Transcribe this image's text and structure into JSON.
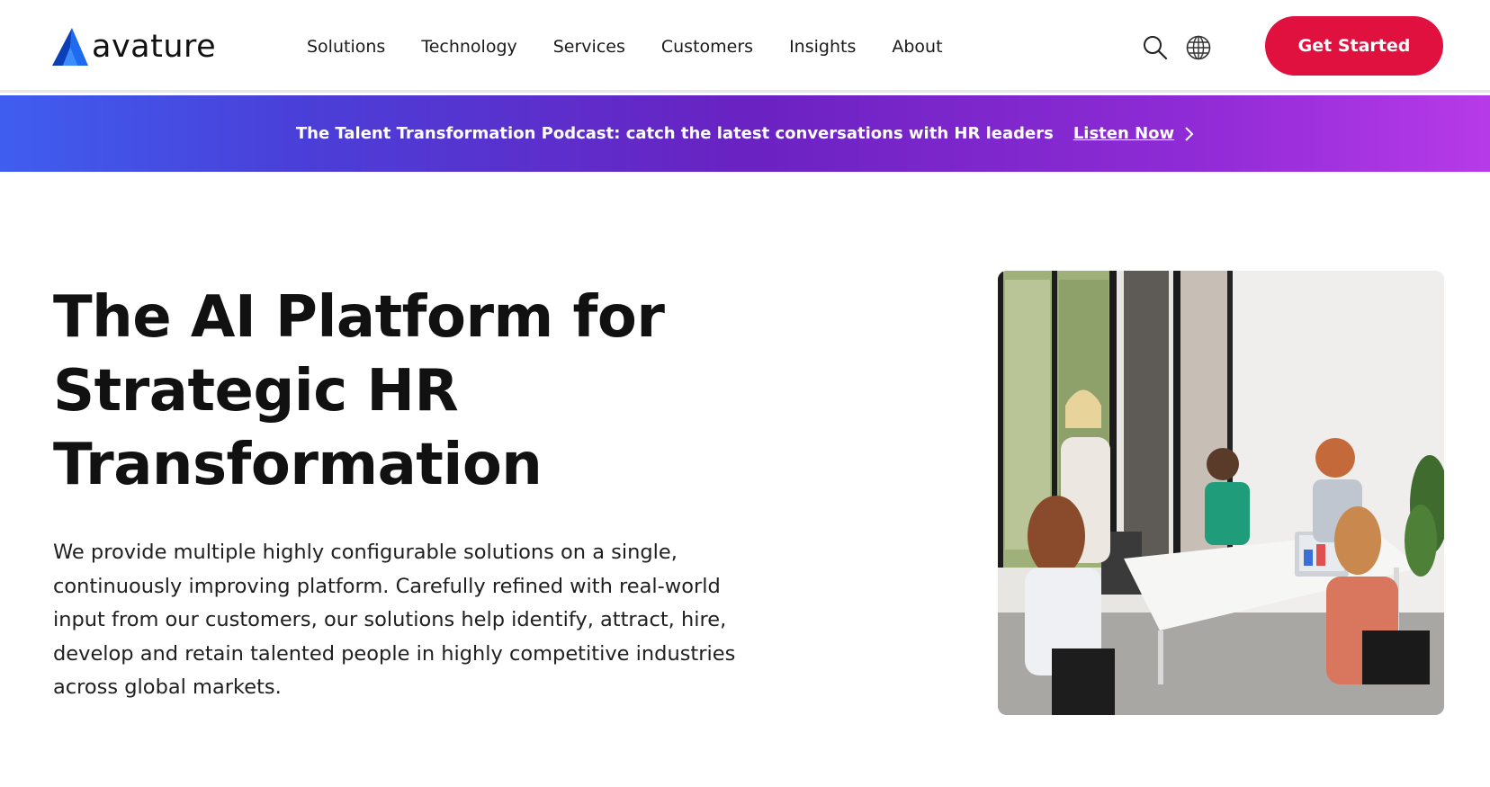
{
  "brand": {
    "name": "avature",
    "accent": "#1f6bf0",
    "cta_color": "#e0103f"
  },
  "nav": {
    "items": [
      {
        "label": "Solutions"
      },
      {
        "label": "Technology"
      },
      {
        "label": "Services"
      },
      {
        "label": "Customers"
      },
      {
        "label": "Insights"
      },
      {
        "label": "About"
      }
    ],
    "search_icon": "search-icon",
    "language_icon": "globe-icon",
    "cta_label": "Get Started"
  },
  "banner": {
    "text": "The Talent Transformation Podcast: catch the latest conversations with HR leaders",
    "link_label": "Listen Now",
    "link_icon": "chevron-right-icon"
  },
  "hero": {
    "title_lines": [
      "The AI Platform for",
      "Strategic HR",
      "Transformation"
    ],
    "description": "We provide multiple highly configurable solutions on a single, continuously improving platform. Carefully refined with real-world input from our customers, our solutions help identify, attract, hire, develop and retain talented people in highly competitive industries across global markets.",
    "image_subject": "team-meeting-photo"
  }
}
